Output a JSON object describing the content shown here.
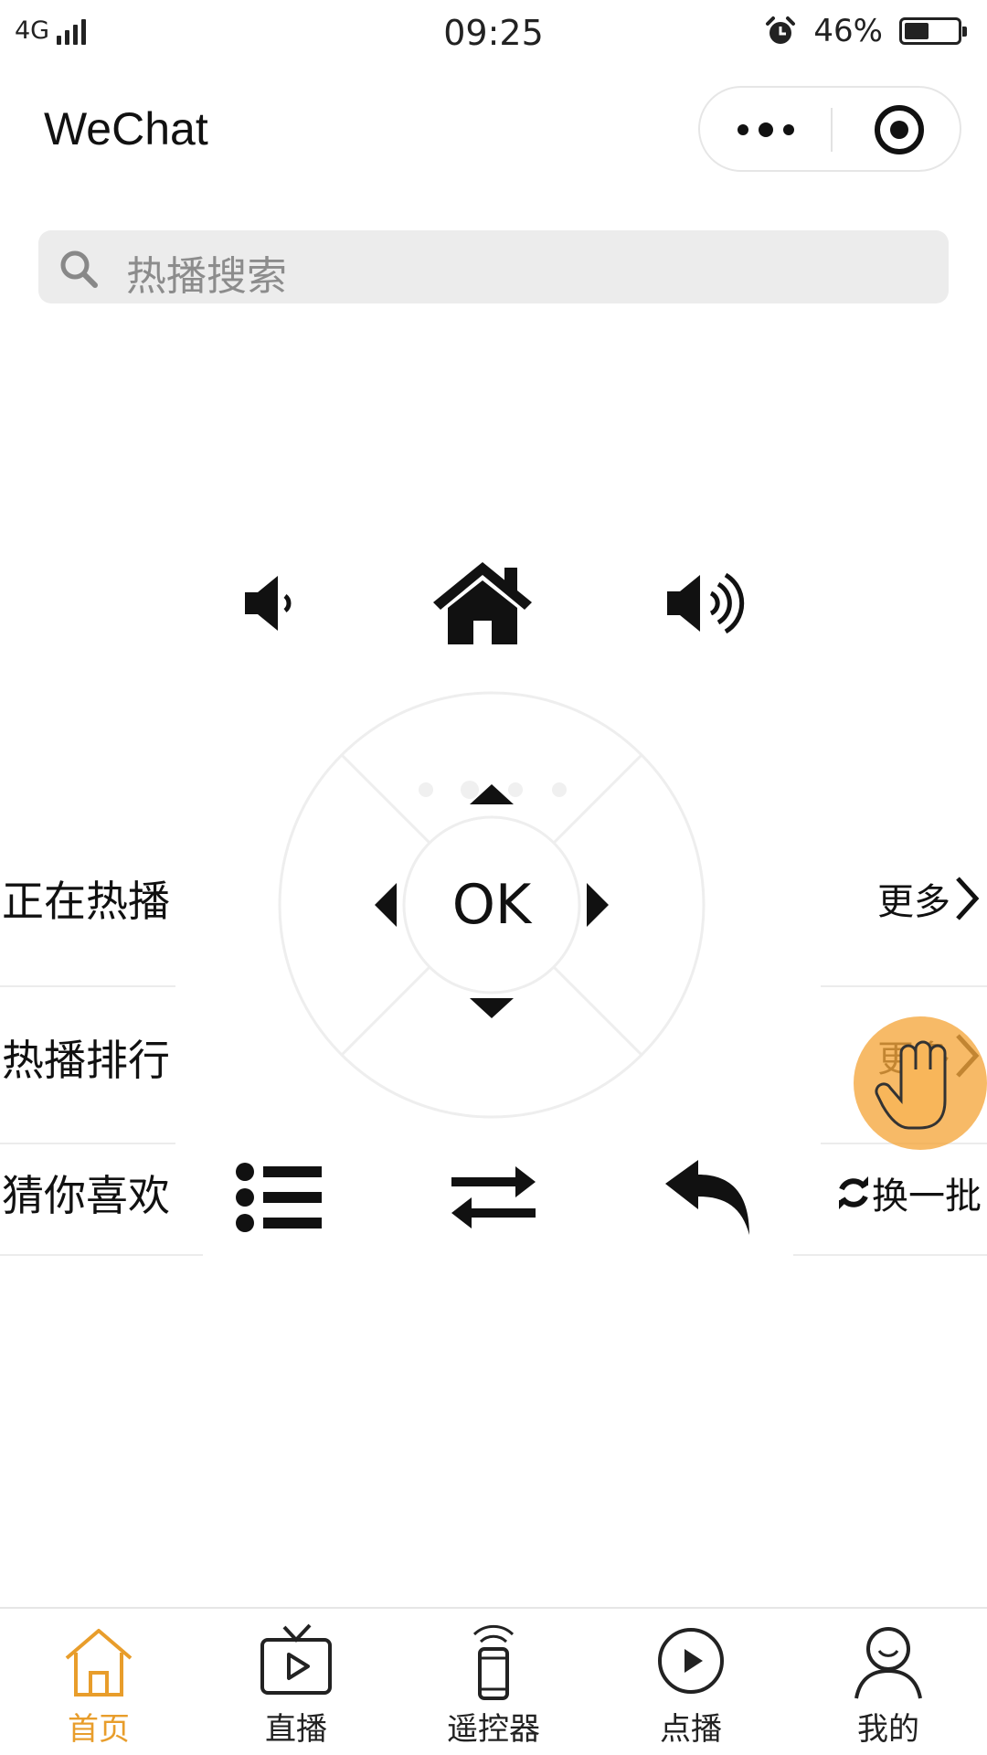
{
  "status_bar": {
    "network": "4G",
    "time": "09:25",
    "battery_percent": "46%",
    "battery_level": 0.46
  },
  "nav": {
    "title": "WeChat"
  },
  "search": {
    "placeholder": "热播搜索"
  },
  "sections": [
    {
      "label": "正在热播",
      "action": "更多"
    },
    {
      "label": "热播排行",
      "action": "更多"
    },
    {
      "label": "猜你喜欢",
      "action": "换一批"
    }
  ],
  "remote": {
    "ok_label": "OK",
    "top_buttons": [
      "volume-down-icon",
      "home-icon",
      "volume-up-icon"
    ],
    "bottom_buttons": [
      "menu-list-icon",
      "switch-icon",
      "back-icon"
    ]
  },
  "tabbar": {
    "active_color": "#e89d2b",
    "items": [
      {
        "label": "首页",
        "icon": "home-icon"
      },
      {
        "label": "直播",
        "icon": "tv-icon"
      },
      {
        "label": "遥控器",
        "icon": "remote-control-icon"
      },
      {
        "label": "点播",
        "icon": "play-circle-icon"
      },
      {
        "label": "我的",
        "icon": "user-icon"
      }
    ]
  }
}
